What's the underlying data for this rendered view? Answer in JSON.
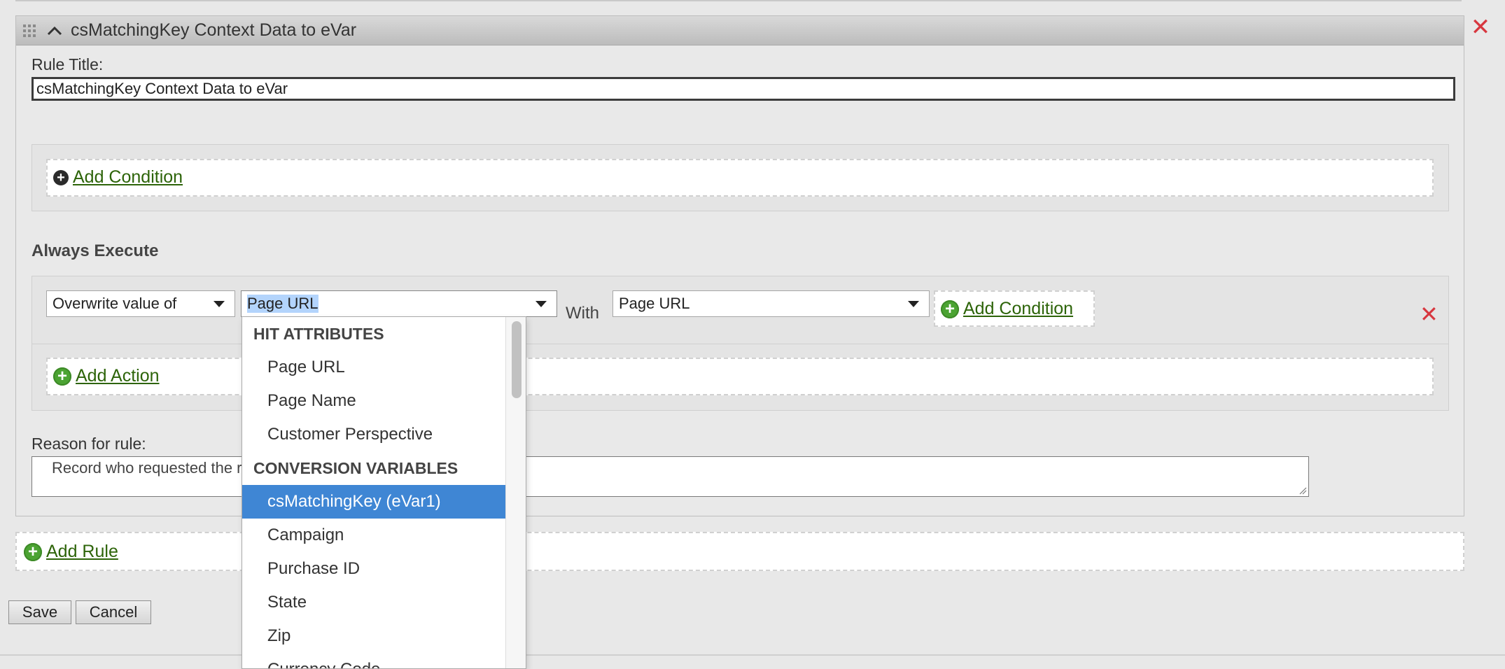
{
  "rule": {
    "header_title": "csMatchingKey Context Data to eVar",
    "title_label": "Rule Title:",
    "title_value": "csMatchingKey Context Data to eVar",
    "add_condition_label": "Add Condition",
    "always_execute_label": "Always Execute",
    "action": {
      "operation": "Overwrite value of",
      "target": "Page URL",
      "with_label": "With",
      "source": "Page URL",
      "add_condition_label": "Add Condition"
    },
    "add_action_label": "Add Action",
    "reason_label": "Reason for rule:",
    "reason_value": "Record who requested the r"
  },
  "add_rule_label": "Add Rule",
  "buttons": {
    "save": "Save",
    "cancel": "Cancel"
  },
  "dropdown": {
    "groups": [
      {
        "label": "HIT ATTRIBUTES",
        "items": [
          "Page URL",
          "Page Name",
          "Customer Perspective"
        ]
      },
      {
        "label": "CONVERSION VARIABLES",
        "items": [
          "csMatchingKey (eVar1)",
          "Campaign",
          "Purchase ID",
          "State",
          "Zip",
          "Currency Code"
        ]
      }
    ],
    "selected": "csMatchingKey (eVar1)"
  },
  "colors": {
    "link": "#2d6409",
    "delete": "#d7373f",
    "selected_item": "#3f86d4",
    "plus_green": "#4ba332"
  }
}
